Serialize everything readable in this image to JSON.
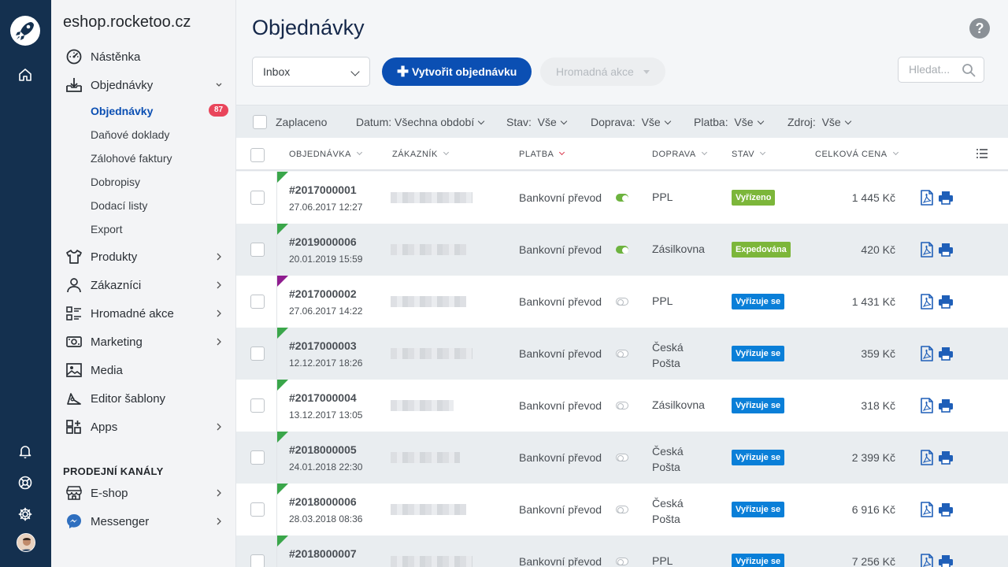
{
  "colors": {
    "rail": "#14304f",
    "accent": "#0b4fb3",
    "badge": "#e9455b",
    "green": "#7cb63a",
    "blue": "#0a7fd8",
    "flag_green": "#3aa64a",
    "flag_purple": "#8f1c8f"
  },
  "sidebar": {
    "shop_name": "eshop.rocketoo.cz",
    "items": [
      {
        "label": "Nástěnka",
        "icon": "dashboard-icon"
      },
      {
        "label": "Objednávky",
        "icon": "inbox-download-icon"
      },
      {
        "label": "Produkty",
        "icon": "shirt-icon"
      },
      {
        "label": "Zákazníci",
        "icon": "user-icon"
      },
      {
        "label": "Hromadné akce",
        "icon": "bulk-actions-icon"
      },
      {
        "label": "Marketing",
        "icon": "megaphone-icon"
      },
      {
        "label": "Media",
        "icon": "image-icon"
      },
      {
        "label": "Editor šablony",
        "icon": "design-editor-icon"
      },
      {
        "label": "Apps",
        "icon": "apps-grid-icon"
      }
    ],
    "sub_items": [
      "Objednávky",
      "Daňové doklady",
      "Zálohové faktury",
      "Dobropisy",
      "Dodací listy",
      "Export"
    ],
    "orders_badge": "87",
    "channels_heading": "PRODEJNÍ KANÁLY",
    "channels": [
      {
        "label": "E-shop",
        "icon": "storefront-icon"
      },
      {
        "label": "Messenger",
        "icon": "messenger-icon"
      }
    ]
  },
  "header": {
    "title": "Objednávky",
    "inbox_select": "Inbox",
    "create_button": "Vytvořit objednávku",
    "bulk_button": "Hromadná akce",
    "search_placeholder": "Hledat..."
  },
  "filters": {
    "paid": "Zaplaceno",
    "date": "Datum: Všechna období",
    "state": "Stav:  Vše",
    "shipping": "Doprava:  Vše",
    "payment": "Platba:  Vše",
    "source": "Zdroj:  Vše"
  },
  "table": {
    "columns": [
      "OBJEDNÁVKA",
      "ZÁKAZNÍK",
      "PLATBA",
      "DOPRAVA",
      "STAV",
      "CELKOVÁ CENA"
    ],
    "rows": [
      {
        "number": "#2017000001",
        "date": "27.06.2017 12:27",
        "payment": "Bankovní převod",
        "paid": true,
        "shipping": "PPL",
        "status": "Vyřízeno",
        "status_color": "#7cb63a",
        "price": "1 445 Kč",
        "flag": "green"
      },
      {
        "number": "#2019000006",
        "date": "20.01.2019 15:59",
        "payment": "Bankovní převod",
        "paid": true,
        "shipping": "Zásilkovna",
        "status": "Expedována",
        "status_color": "#7cb63a",
        "price": "420 Kč",
        "flag": "green"
      },
      {
        "number": "#2017000002",
        "date": "27.06.2017 14:22",
        "payment": "Bankovní převod",
        "paid": false,
        "shipping": "PPL",
        "status": "Vyřizuje se",
        "status_color": "#0a7fd8",
        "price": "1 431 Kč",
        "flag": "purple"
      },
      {
        "number": "#2017000003",
        "date": "12.12.2017 18:26",
        "payment": "Bankovní převod",
        "paid": false,
        "shipping": "Česká Pošta",
        "status": "Vyřizuje se",
        "status_color": "#0a7fd8",
        "price": "359 Kč",
        "flag": "green"
      },
      {
        "number": "#2017000004",
        "date": "13.12.2017 13:05",
        "payment": "Bankovní převod",
        "paid": false,
        "shipping": "Zásilkovna",
        "status": "Vyřizuje se",
        "status_color": "#0a7fd8",
        "price": "318 Kč",
        "flag": "green"
      },
      {
        "number": "#2018000005",
        "date": "24.01.2018 22:30",
        "payment": "Bankovní převod",
        "paid": false,
        "shipping": "Česká Pošta",
        "status": "Vyřizuje se",
        "status_color": "#0a7fd8",
        "price": "2 399 Kč",
        "flag": "green"
      },
      {
        "number": "#2018000006",
        "date": "28.03.2018 08:36",
        "payment": "Bankovní převod",
        "paid": false,
        "shipping": "Česká Pošta",
        "status": "Vyřizuje se",
        "status_color": "#0a7fd8",
        "price": "6 916 Kč",
        "flag": "green"
      },
      {
        "number": "#2018000007",
        "date": "",
        "payment": "Bankovní převod",
        "paid": false,
        "shipping": "PPL",
        "status": "Vyřizuje se",
        "status_color": "#0a7fd8",
        "price": "7 256 Kč",
        "flag": "green"
      }
    ]
  }
}
